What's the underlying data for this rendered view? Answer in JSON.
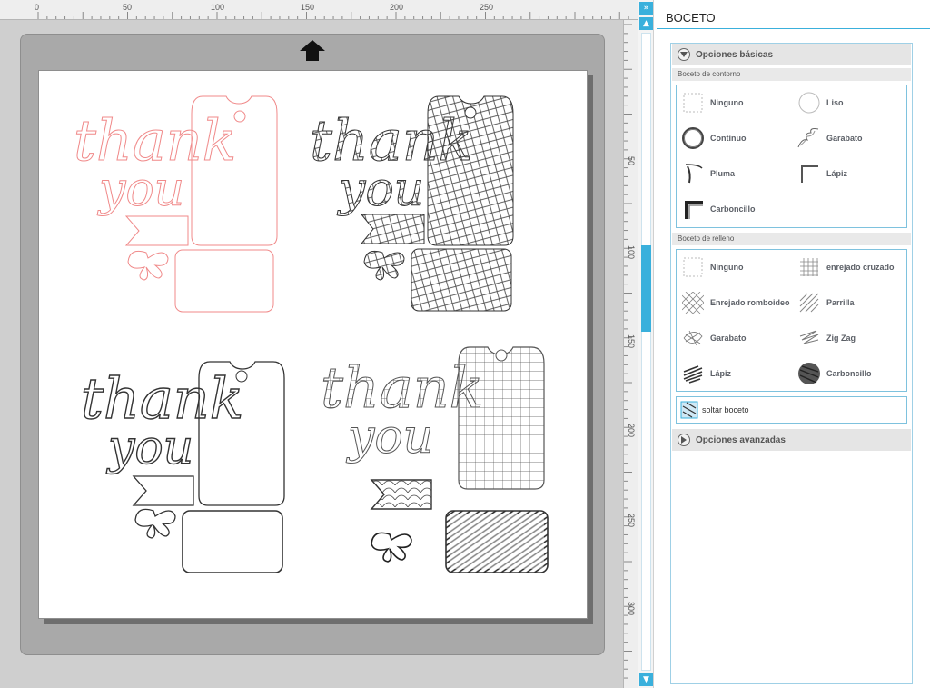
{
  "ruler": {
    "top_labels": [
      "0",
      "50",
      "100",
      "150",
      "200",
      "250"
    ],
    "left_labels": [
      "50",
      "100",
      "150",
      "200",
      "250",
      "300"
    ]
  },
  "canvas": {
    "designs": [
      {
        "thank": "thank",
        "you": "you"
      },
      {
        "thank": "thank",
        "you": "you"
      },
      {
        "thank": "thank",
        "you": "you"
      },
      {
        "thank": "thank",
        "you": "you"
      }
    ],
    "colors": {
      "outline_red": "#f08a8a",
      "stroke_dark": "#333333",
      "mat": "#a9a9a9",
      "accent": "#3ab0dc"
    }
  },
  "panel": {
    "title": "BOCETO",
    "basic_section": "Opciones básicas",
    "outline_subtitle": "Boceto de contorno",
    "outline_options": [
      {
        "label": "Ninguno",
        "icon": "none-icon"
      },
      {
        "label": "Liso",
        "icon": "smooth-circle-icon"
      },
      {
        "label": "Continuo",
        "icon": "continuous-circle-icon"
      },
      {
        "label": "Garabato",
        "icon": "scribble-icon"
      },
      {
        "label": "Pluma",
        "icon": "pen-icon"
      },
      {
        "label": "Lápiz",
        "icon": "pencil-corner-icon"
      },
      {
        "label": "Carboncillo",
        "icon": "charcoal-corner-icon"
      }
    ],
    "fill_subtitle": "Boceto de relleno",
    "fill_options": [
      {
        "label": "Ninguno",
        "icon": "none-icon"
      },
      {
        "label": "enrejado cruzado",
        "icon": "crosshatch-icon"
      },
      {
        "label": "Enrejado romboideo",
        "icon": "diamond-lattice-icon"
      },
      {
        "label": "Parrilla",
        "icon": "grill-icon"
      },
      {
        "label": "Garabato",
        "icon": "scribble-fill-icon"
      },
      {
        "label": "Zig Zag",
        "icon": "zigzag-icon"
      },
      {
        "label": "Lápiz",
        "icon": "pencil-fill-icon"
      },
      {
        "label": "Carboncillo",
        "icon": "charcoal-fill-icon"
      }
    ],
    "release_label": "soltar boceto",
    "advanced_section": "Opciones avanzadas"
  }
}
